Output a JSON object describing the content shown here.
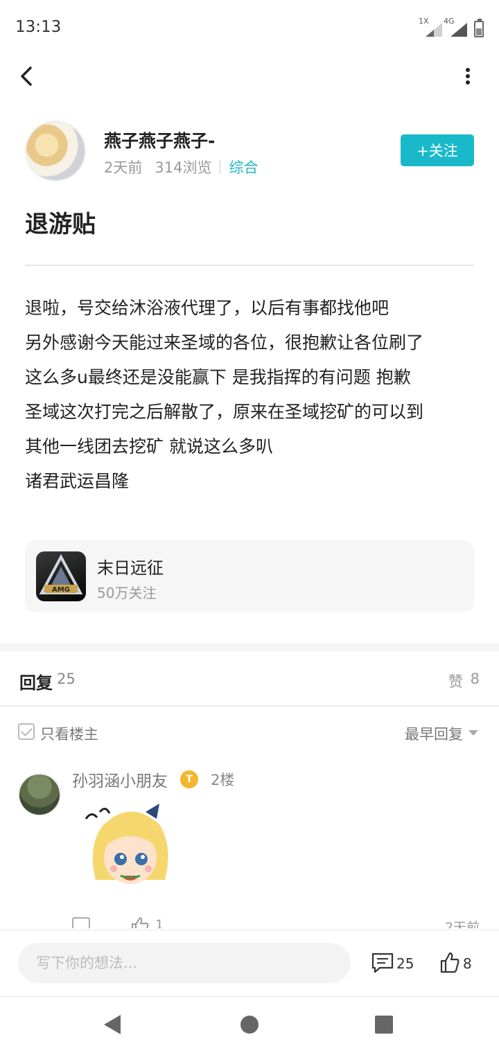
{
  "status_bar": {
    "time": "13:13",
    "sim1_label": "1X",
    "sim2_label": "4G"
  },
  "author": {
    "name": "燕子燕子燕子-",
    "time_ago": "2天前",
    "views": "314浏览",
    "category": "综合",
    "follow_label": "+关注"
  },
  "post": {
    "title": "退游贴",
    "body_lines": [
      "退啦，号交给沐浴液代理了，以后有事都找他吧",
      "另外感谢今天能过来圣域的各位，很抱歉让各位刷了",
      "这么多u最终还是没能赢下 是我指挥的有问题 抱歉",
      "圣域这次打完之后解散了，原来在圣域挖矿的可以到",
      "其他一线团去挖矿 就说这么多叭",
      "诸君武运昌隆"
    ]
  },
  "game_card": {
    "name": "末日远征",
    "followers": "50万关注",
    "icon_text": "AMG"
  },
  "replies_header": {
    "reply_label": "回复",
    "reply_count": "25",
    "like_label": "赞",
    "like_count": "8"
  },
  "filter": {
    "only_op_label": "只看楼主",
    "sort_label": "最早回复"
  },
  "comments": [
    {
      "user": "孙羽涵小朋友",
      "level_badge": "T",
      "floor": "2楼",
      "like_count": "1",
      "time": "2天前"
    }
  ],
  "bottom_bar": {
    "input_placeholder": "写下你的想法...",
    "comment_count": "25",
    "like_count": "8"
  },
  "colors": {
    "accent": "#19b9c9",
    "badge": "#f4b62c"
  },
  "icons": [
    "back-arrow-icon",
    "more-vert-icon",
    "checkbox-icon",
    "reply-icon",
    "thumbs-up-icon",
    "comment-icon",
    "nav-back-icon",
    "nav-home-icon",
    "nav-recent-icon"
  ]
}
